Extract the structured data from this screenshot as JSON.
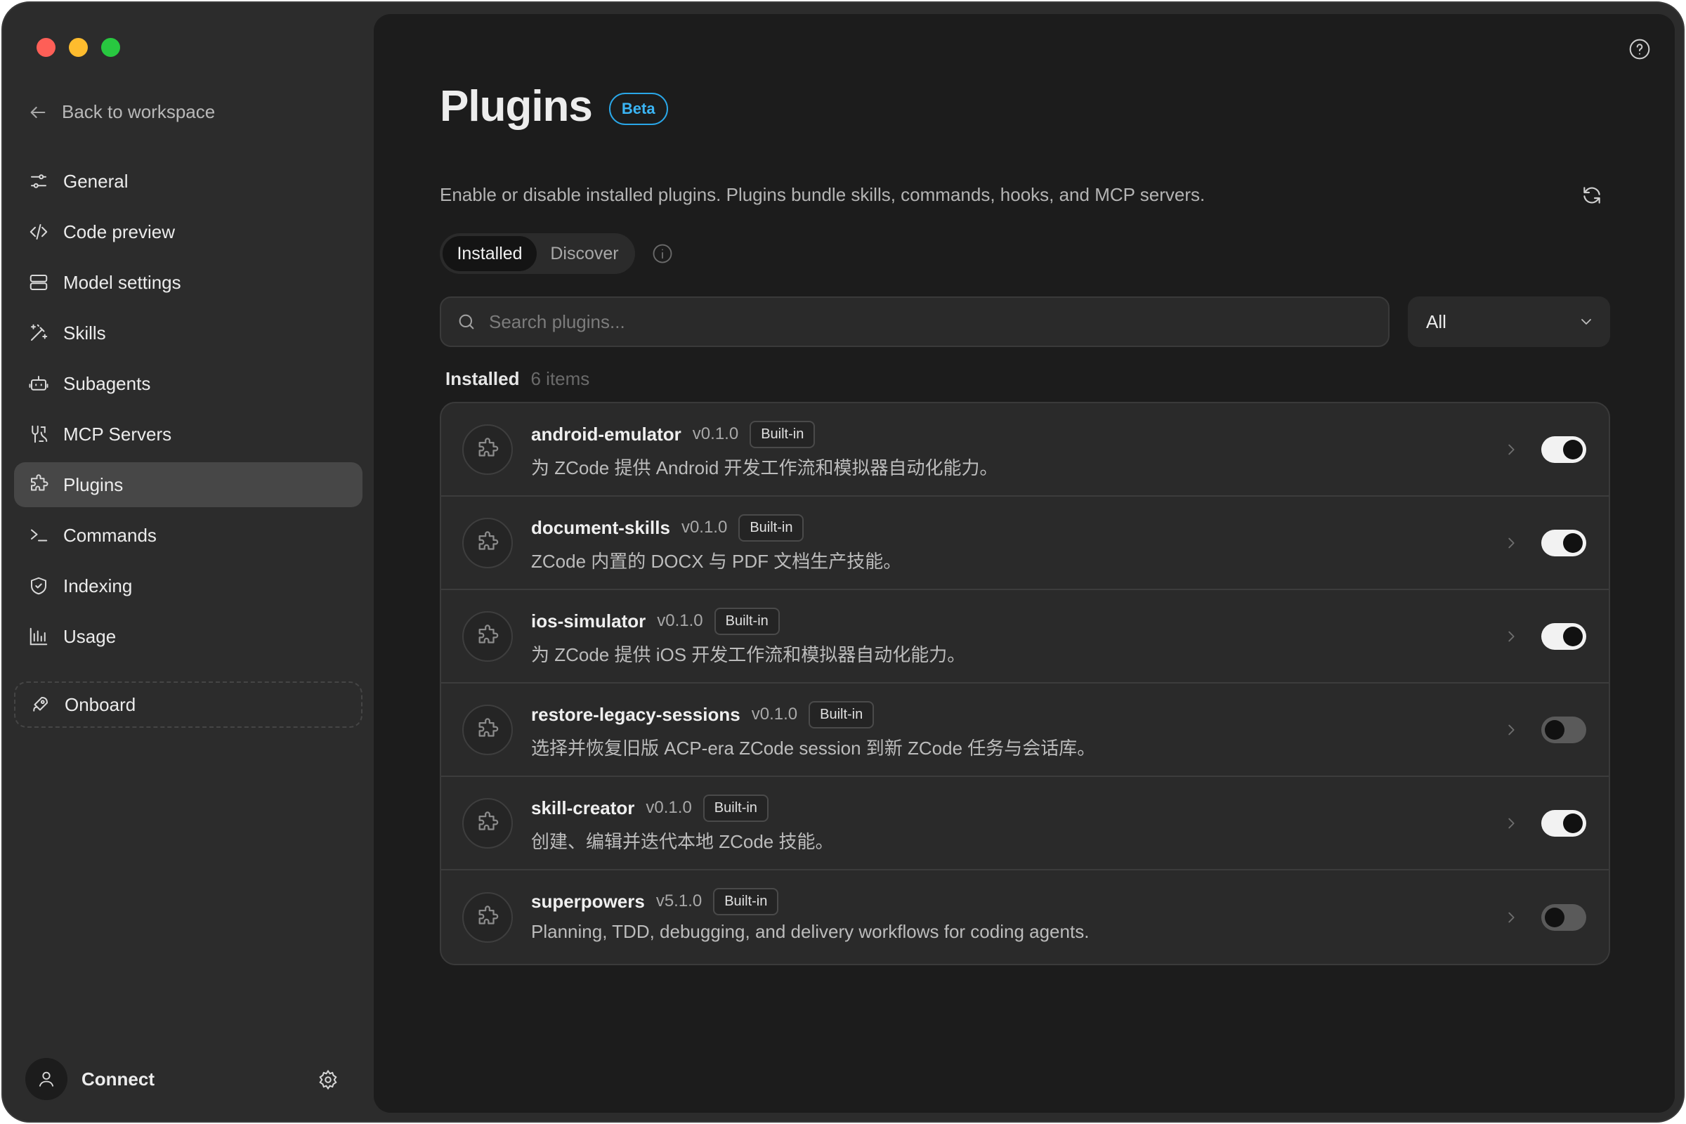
{
  "sidebar": {
    "back_label": "Back to workspace",
    "items": [
      {
        "label": "General",
        "icon": "sliders-icon"
      },
      {
        "label": "Code preview",
        "icon": "code-icon"
      },
      {
        "label": "Model settings",
        "icon": "server-icon"
      },
      {
        "label": "Skills",
        "icon": "magic-wand-icon"
      },
      {
        "label": "Subagents",
        "icon": "bot-icon"
      },
      {
        "label": "MCP Servers",
        "icon": "mcp-icon"
      },
      {
        "label": "Plugins",
        "icon": "puzzle-icon",
        "active": true
      },
      {
        "label": "Commands",
        "icon": "terminal-icon"
      },
      {
        "label": "Indexing",
        "icon": "shield-icon"
      },
      {
        "label": "Usage",
        "icon": "bar-chart-icon"
      }
    ],
    "onboard_label": "Onboard",
    "connect_label": "Connect"
  },
  "header": {
    "title": "Plugins",
    "badge": "Beta",
    "description": "Enable or disable installed plugins. Plugins bundle skills, commands, hooks, and MCP servers."
  },
  "tabs": {
    "installed": "Installed",
    "discover": "Discover"
  },
  "search": {
    "placeholder": "Search plugins...",
    "value": ""
  },
  "filter": {
    "selected": "All"
  },
  "section": {
    "title": "Installed",
    "count": "6 items"
  },
  "plugins": [
    {
      "name": "android-emulator",
      "version": "v0.1.0",
      "badge": "Built-in",
      "description": "为 ZCode 提供 Android 开发工作流和模拟器自动化能力。",
      "enabled": true
    },
    {
      "name": "document-skills",
      "version": "v0.1.0",
      "badge": "Built-in",
      "description": "ZCode 内置的 DOCX 与 PDF 文档生产技能。",
      "enabled": true
    },
    {
      "name": "ios-simulator",
      "version": "v0.1.0",
      "badge": "Built-in",
      "description": "为 ZCode 提供 iOS 开发工作流和模拟器自动化能力。",
      "enabled": true
    },
    {
      "name": "restore-legacy-sessions",
      "version": "v0.1.0",
      "badge": "Built-in",
      "description": "选择并恢复旧版 ACP-era ZCode session 到新 ZCode 任务与会话库。",
      "enabled": false
    },
    {
      "name": "skill-creator",
      "version": "v0.1.0",
      "badge": "Built-in",
      "description": "创建、编辑并迭代本地 ZCode 技能。",
      "enabled": true
    },
    {
      "name": "superpowers",
      "version": "v5.1.0",
      "badge": "Built-in",
      "description": "Planning, TDD, debugging, and delivery workflows for coding agents.",
      "enabled": false
    }
  ],
  "colors": {
    "accent": "#3bb5f5",
    "window_bg": "#2c2c2c",
    "panel_bg": "#1c1c1c"
  }
}
